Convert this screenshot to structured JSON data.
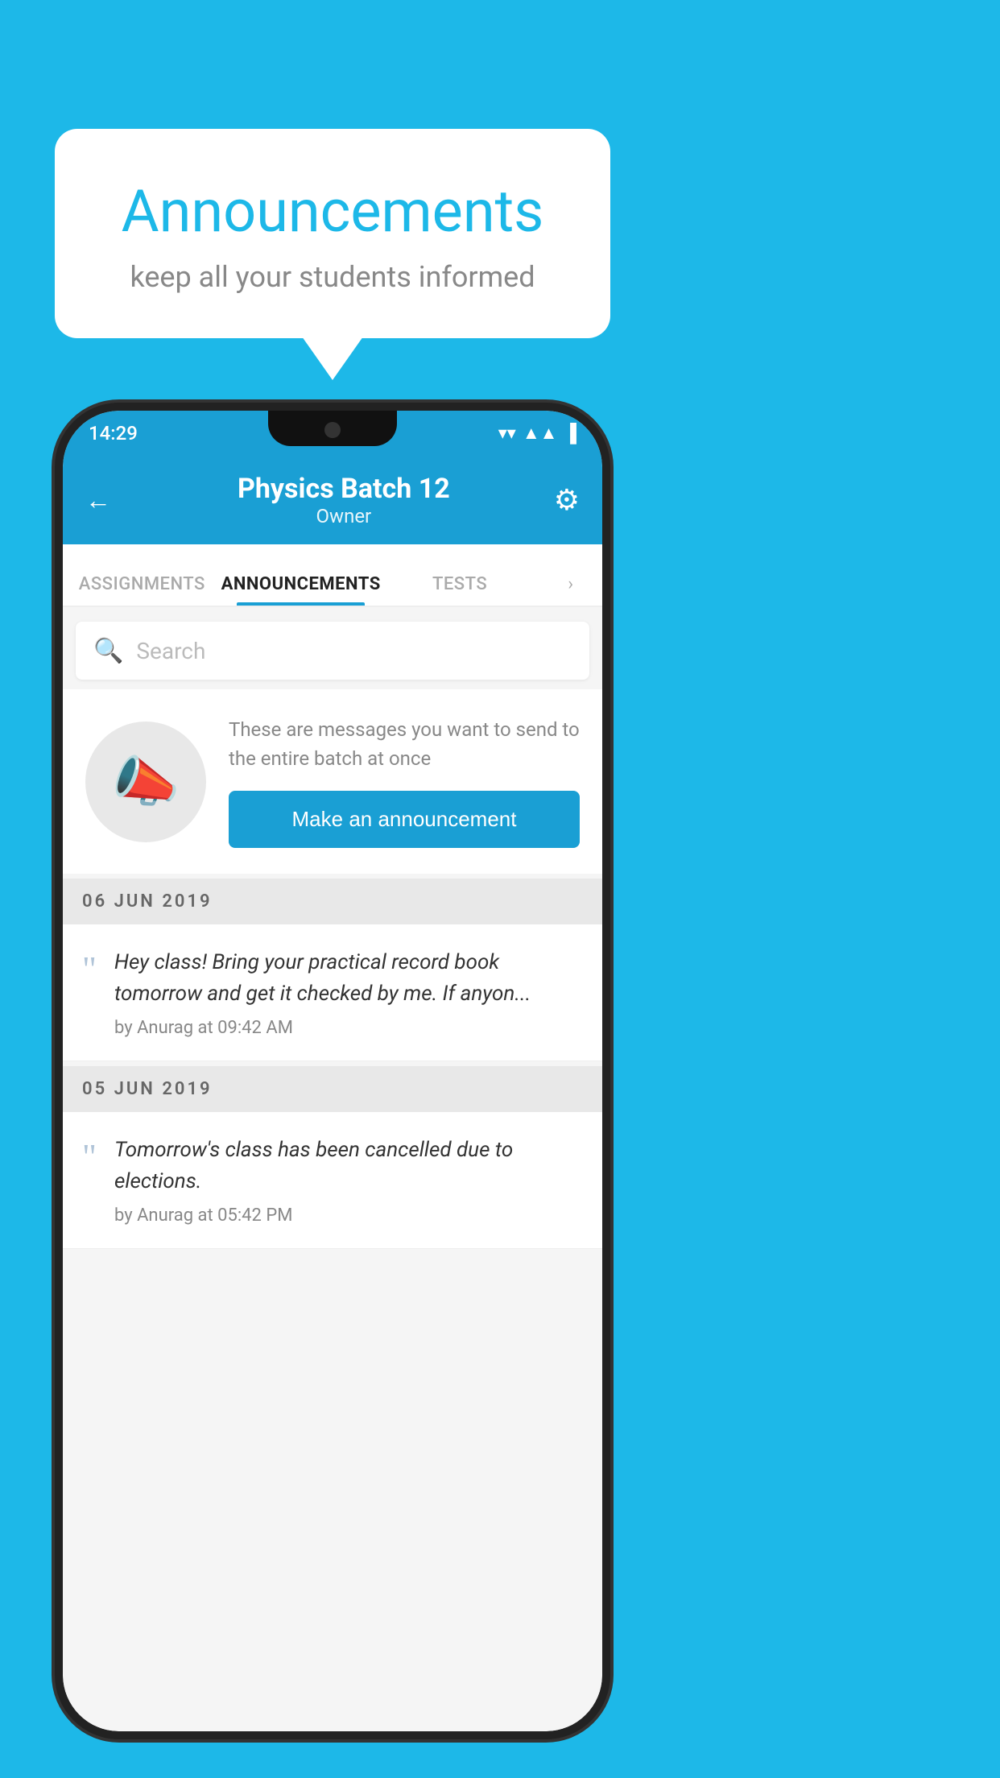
{
  "background_color": "#1DB8E8",
  "bubble": {
    "title": "Announcements",
    "subtitle": "keep all your students informed"
  },
  "phone": {
    "status_bar": {
      "time": "14:29",
      "wifi": "▼",
      "signal": "▲",
      "battery": "▪"
    },
    "header": {
      "title": "Physics Batch 12",
      "subtitle": "Owner",
      "back_label": "←",
      "gear_label": "⚙"
    },
    "tabs": [
      {
        "label": "ASSIGNMENTS",
        "active": false
      },
      {
        "label": "ANNOUNCEMENTS",
        "active": true
      },
      {
        "label": "TESTS",
        "active": false
      }
    ],
    "search": {
      "placeholder": "Search"
    },
    "promo": {
      "description": "These are messages you want to send to the entire batch at once",
      "button_label": "Make an announcement"
    },
    "announcements": [
      {
        "date": "06  JUN  2019",
        "message": "Hey class! Bring your practical record book tomorrow and get it checked by me. If anyon...",
        "author": "by Anurag at 09:42 AM"
      },
      {
        "date": "05  JUN  2019",
        "message": "Tomorrow's class has been cancelled due to elections.",
        "author": "by Anurag at 05:42 PM"
      }
    ]
  }
}
